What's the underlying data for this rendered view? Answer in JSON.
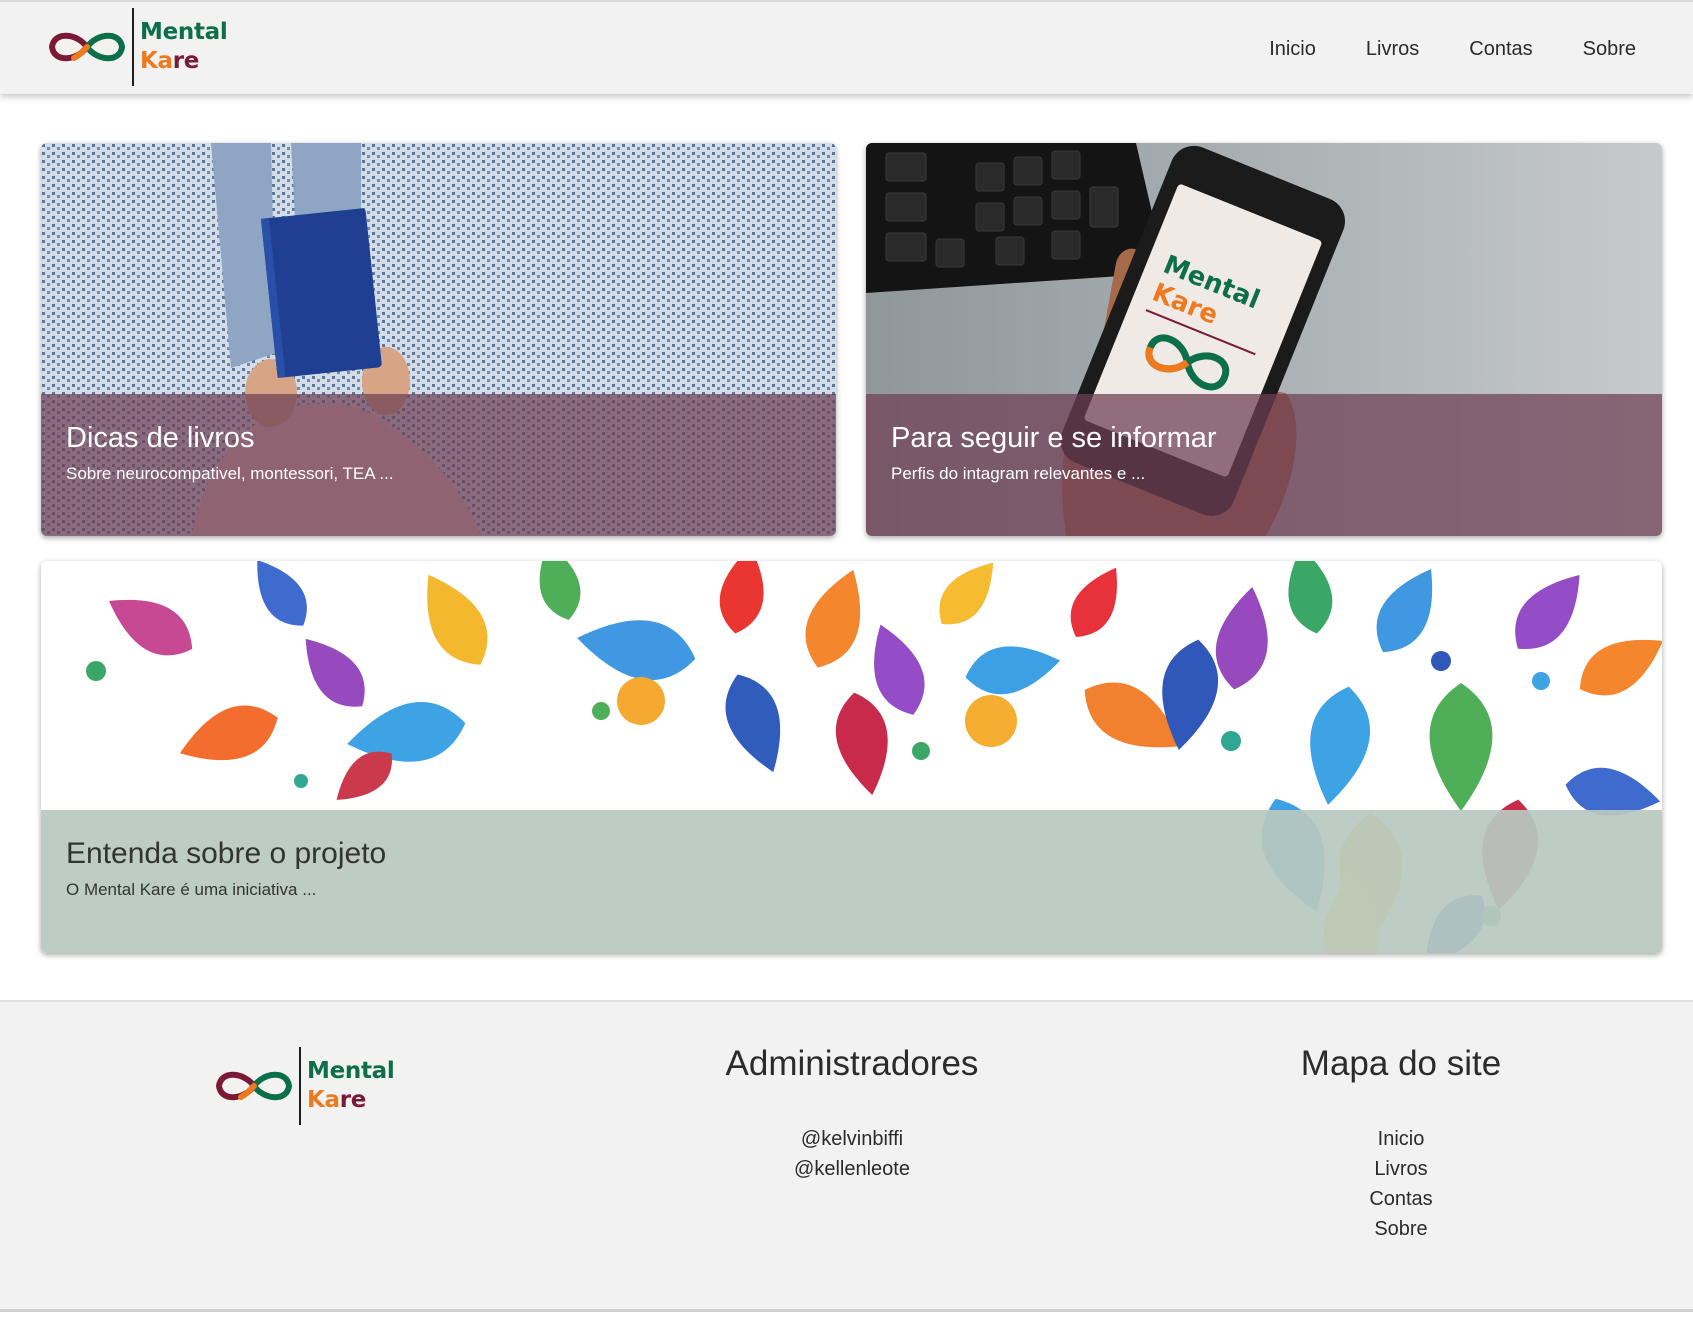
{
  "brand": {
    "line1": "Mental",
    "line2_a": "Ka",
    "line2_b": "re"
  },
  "nav": [
    "Inicio",
    "Livros",
    "Contas",
    "Sobre"
  ],
  "cards": [
    {
      "title": "Dicas de livros",
      "subtitle": "Sobre neurocompativel, montessori, TEA ...",
      "image": "person-holding-blue-book-on-rug"
    },
    {
      "title": "Para seguir e se informar",
      "subtitle": "Perfis do intagram relevantes e ...",
      "image": "hand-holding-phone-with-mental-kare-logo"
    },
    {
      "title": "Entenda sobre o projeto",
      "subtitle": "O Mental Kare é uma iniciativa ...",
      "image": "colorful-watercolor-drops"
    }
  ],
  "phone_logo": {
    "line1": "Mental",
    "line2": "Kare"
  },
  "footer": {
    "admins": {
      "title": "Administradores",
      "items": [
        "@kelvinbiffi",
        "@kellenleote"
      ]
    },
    "sitemap": {
      "title": "Mapa do site",
      "items": [
        "Inicio",
        "Livros",
        "Contas",
        "Sobre"
      ]
    }
  },
  "colors": {
    "brand_green": "#0d6e4a",
    "brand_orange": "#ef7a1e",
    "brand_maroon": "#7a1a36",
    "caption_maroon": "#6e3e54",
    "caption_sage": "#b8c8c0",
    "surface": "#f2f2f2"
  }
}
